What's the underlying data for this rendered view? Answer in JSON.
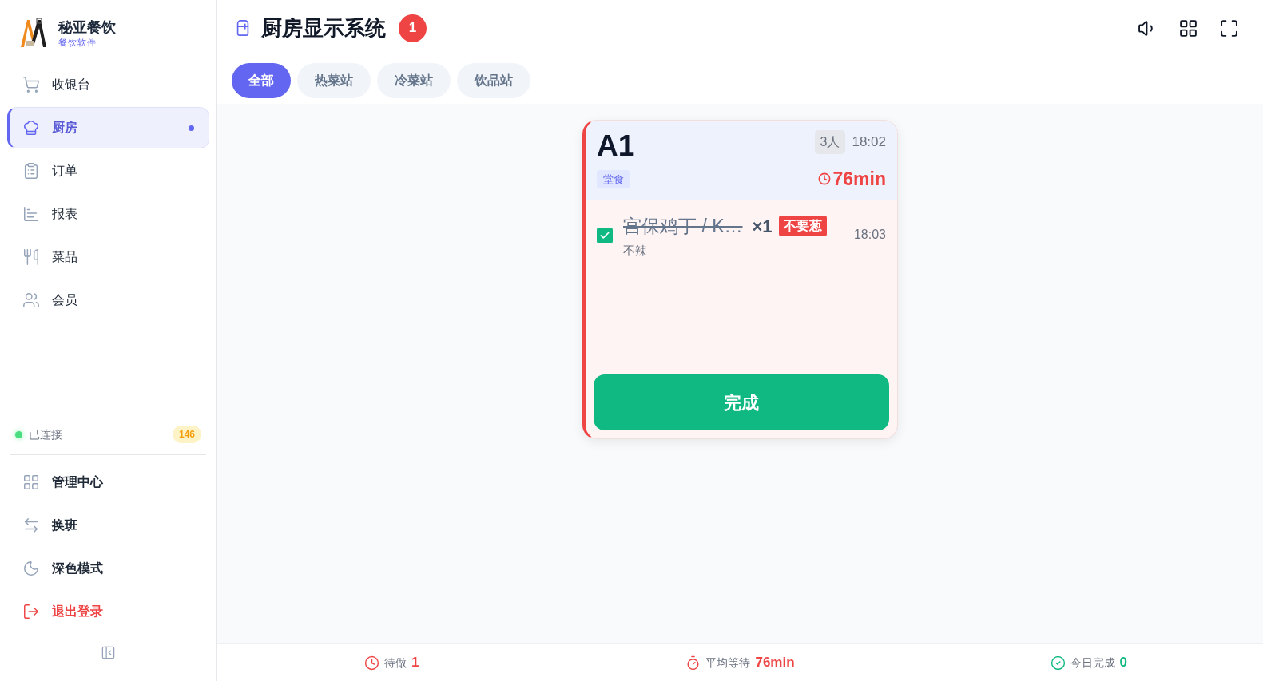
{
  "brand": {
    "name": "秘亚餐饮",
    "subtitle": "餐饮软件"
  },
  "nav": [
    {
      "label": "收银台",
      "selected": false
    },
    {
      "label": "厨房",
      "selected": true
    },
    {
      "label": "订单",
      "selected": false
    },
    {
      "label": "报表",
      "selected": false
    },
    {
      "label": "菜品",
      "selected": false
    },
    {
      "label": "会员",
      "selected": false
    }
  ],
  "connection": {
    "label": "已连接",
    "connected": true,
    "count": "146"
  },
  "bottom_nav": [
    {
      "label": "管理中心",
      "kind": "normal"
    },
    {
      "label": "换班",
      "kind": "normal"
    },
    {
      "label": "深色模式",
      "kind": "normal"
    },
    {
      "label": "退出登录",
      "kind": "danger"
    }
  ],
  "header": {
    "title": "厨房显示系统",
    "badge": "1"
  },
  "tabs": [
    {
      "label": "全部",
      "selected": true
    },
    {
      "label": "热菜站",
      "selected": false
    },
    {
      "label": "冷菜站",
      "selected": false
    },
    {
      "label": "饮品站",
      "selected": false
    }
  ],
  "orders": [
    {
      "table": "A1",
      "guests": "3人",
      "time": "18:02",
      "type": "堂食",
      "wait": "76min",
      "urgent": true,
      "items": [
        {
          "name": "宫保鸡丁 / K…",
          "qty": "×1",
          "tag": "不要葱",
          "note": "不辣",
          "time": "18:03",
          "checked": true
        }
      ],
      "action": "完成"
    }
  ],
  "footer": [
    {
      "label": "待做",
      "value": "1",
      "kind": "pending"
    },
    {
      "label": "平均等待",
      "value": "76min",
      "kind": "wait"
    },
    {
      "label": "今日完成",
      "value": "0",
      "kind": "done"
    }
  ]
}
